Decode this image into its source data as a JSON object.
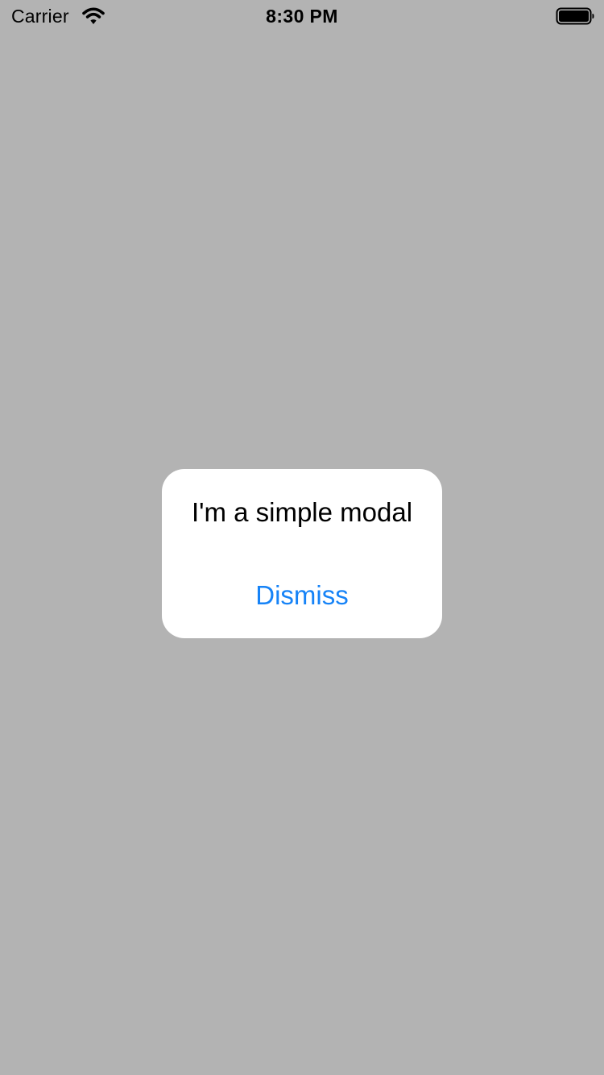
{
  "status_bar": {
    "carrier": "Carrier",
    "time": "8:30 PM",
    "icons": {
      "wifi": "wifi-icon",
      "battery": "battery-icon"
    }
  },
  "modal": {
    "message": "I'm a simple modal",
    "dismiss_label": "Dismiss"
  },
  "colors": {
    "background": "#b3b3b3",
    "modal_background": "#ffffff",
    "action_blue": "#1683f7",
    "text": "#000000"
  }
}
